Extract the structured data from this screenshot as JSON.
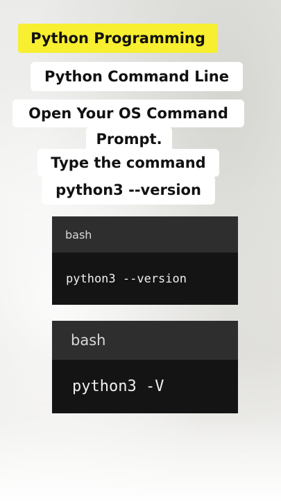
{
  "title": "Python Programming",
  "subtitle": "Python Command Line",
  "instructions": {
    "line1": "Open Your OS Command",
    "line2": "Prompt.",
    "line3": "Type the command",
    "line4": "python3 --version"
  },
  "code_blocks": [
    {
      "lang": "bash",
      "code": "python3 --version"
    },
    {
      "lang": "bash",
      "code": "python3 -V"
    }
  ],
  "colors": {
    "title_highlight": "#f7ef2f",
    "code_header": "#2e2e2e",
    "code_body": "#141414"
  }
}
